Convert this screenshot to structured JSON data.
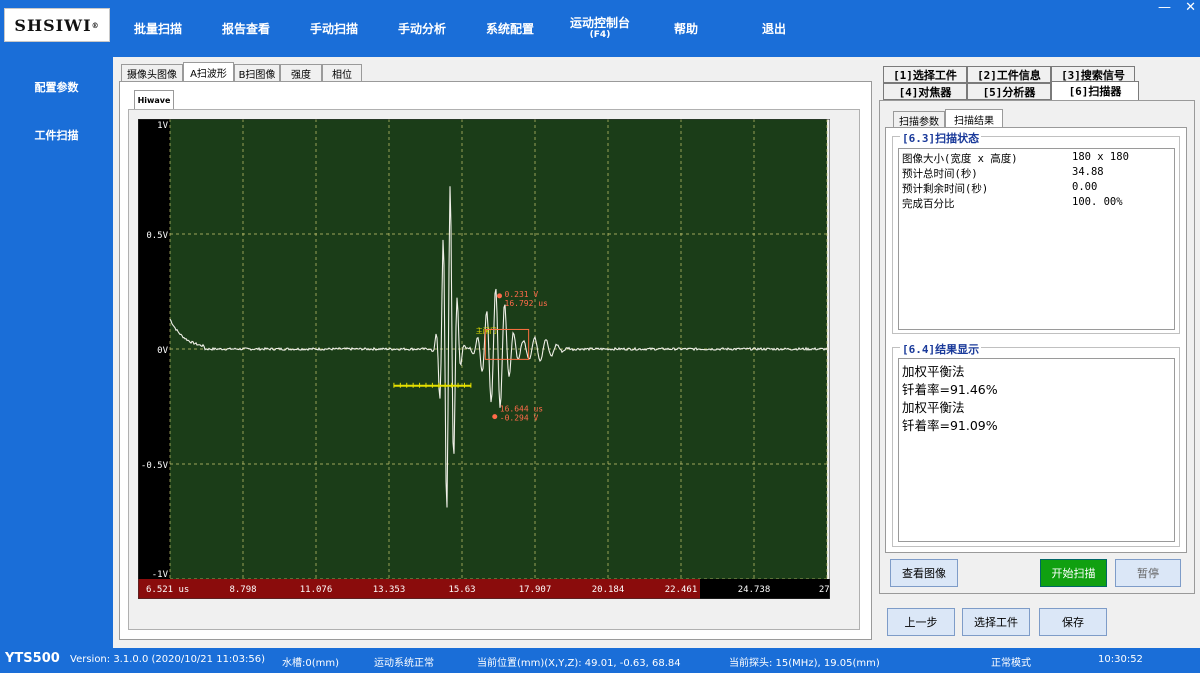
{
  "brand": {
    "logo": "SHSIWI",
    "mark": "®"
  },
  "menu": [
    {
      "label": "批量扫描"
    },
    {
      "label": "报告查看"
    },
    {
      "label": "手动扫描"
    },
    {
      "label": "手动分析"
    },
    {
      "label": "系统配置"
    },
    {
      "label": "运动控制台",
      "sub": "(F4)"
    },
    {
      "label": "帮助"
    },
    {
      "label": "退出"
    }
  ],
  "window_controls": [
    "—",
    "✕"
  ],
  "leftnav": [
    {
      "label": "配置参数"
    },
    {
      "label": "工件扫描"
    }
  ],
  "view_tabs": [
    {
      "label": "摄像头图像"
    },
    {
      "label": "A扫波形",
      "active": true
    },
    {
      "label": "B扫图像"
    },
    {
      "label": "强度"
    },
    {
      "label": "相位"
    }
  ],
  "hiwave_tab": "Hiwave",
  "chart_data": {
    "type": "line",
    "y_ticks": [
      "1V",
      "0.5V",
      "0V",
      "-0.5V",
      "-1V"
    ],
    "ylim": [
      -1,
      1
    ],
    "x_ticks": [
      "6.521 us",
      "8.798",
      "11.076",
      "13.353",
      "15.63",
      "17.907",
      "20.184",
      "22.461",
      "24.738",
      "27."
    ],
    "xlim": [
      6.521,
      27.0
    ],
    "series_color": "#f0f0e8",
    "background": "#1b3d18",
    "grid": true,
    "markers": [
      {
        "value": "0.231 V",
        "time": "16.792 us",
        "y": 0.231,
        "x": 16.792
      },
      {
        "value": "-0.294 V",
        "time": "16.644 us",
        "y": -0.294,
        "x": 16.644
      }
    ],
    "gate_label": "主闸门"
  },
  "right_tabs_row1": [
    {
      "label": "[1]选择工件"
    },
    {
      "label": "[2]工件信息"
    },
    {
      "label": "[3]搜索信号"
    }
  ],
  "right_tabs_row2": [
    {
      "label": "[4]对焦器"
    },
    {
      "label": "[5]分析器"
    },
    {
      "label": "[6]扫描器",
      "active": true
    }
  ],
  "sub_tabs": [
    {
      "label": "扫描参数"
    },
    {
      "label": "扫描结果",
      "active": true
    }
  ],
  "scan_status": {
    "title": "[6.3]扫描状态",
    "rows": [
      {
        "k": "图像大小(宽度 x 高度)",
        "v": "180 x 180"
      },
      {
        "k": "预计总时间(秒)",
        "v": "34.88"
      },
      {
        "k": "预计剩余时间(秒)",
        "v": "0.00"
      },
      {
        "k": "完成百分比",
        "v": "100. 00%"
      }
    ]
  },
  "result_display": {
    "title": "[6.4]结果显示",
    "lines": [
      "加权平衡法",
      "钎着率=91.46%",
      "加权平衡法",
      "钎着率=91.09%"
    ]
  },
  "buttons": {
    "view_image": "查看图像",
    "start_scan": "开始扫描",
    "pause": "暂停",
    "prev_step": "上一步",
    "select_part": "选择工件",
    "save": "保存"
  },
  "statusbar": {
    "brand": "YTS500",
    "version": "Version: 3.1.0.0 (2020/10/21 11:03:56)",
    "tank": "水槽:0(mm)",
    "motion": "运动系统正常",
    "position": "当前位置(mm)(X,Y,Z): 49.01, -0.63, 68.84",
    "probe": "当前探头: 15(MHz), 19.05(mm)",
    "mode": "正常模式",
    "time": "10:30:52"
  }
}
